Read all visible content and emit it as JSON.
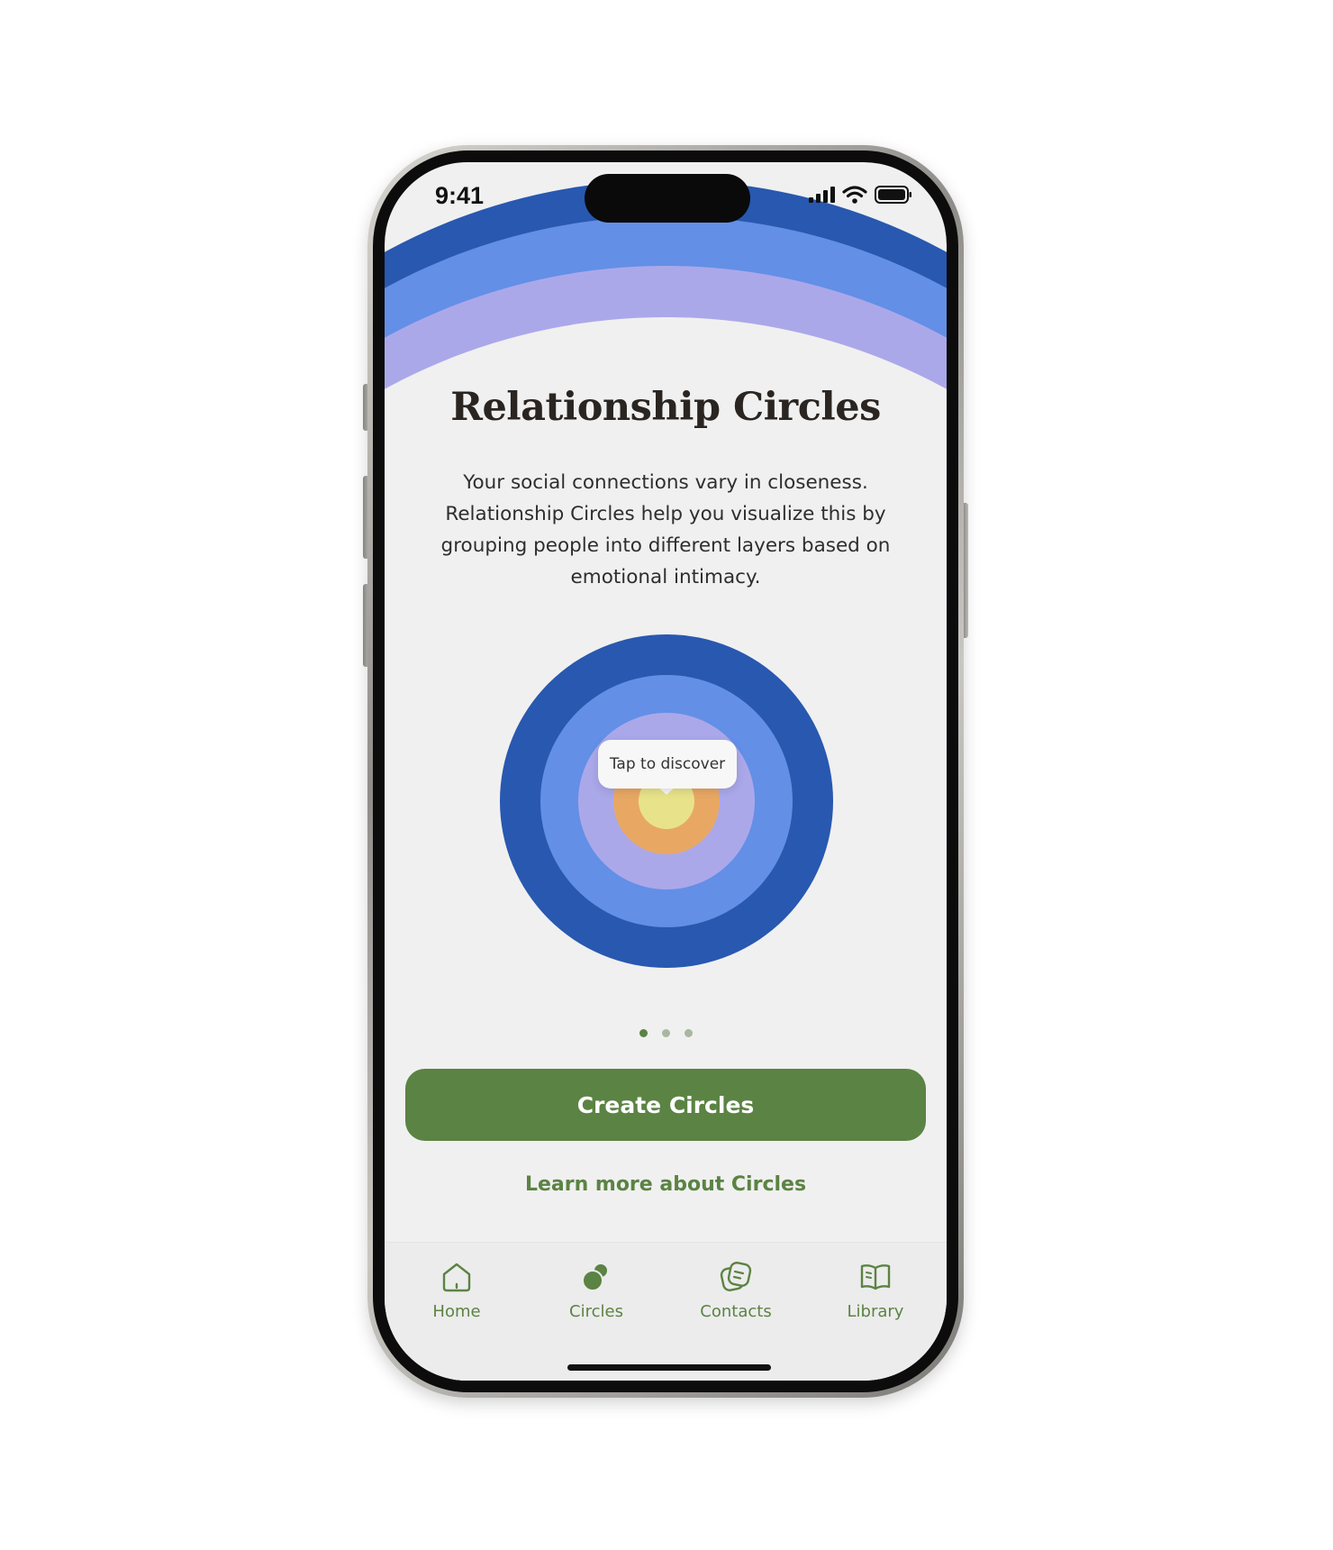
{
  "status_bar": {
    "time": "9:41"
  },
  "intro": {
    "title": "Relationship Circles",
    "description": "Your social connections vary in closeness. Relationship Circles help you visualize this by grouping people into different layers based on emotional intimacy."
  },
  "diagram": {
    "tooltip": "Tap to discover",
    "ring_colors": [
      "#2858b0",
      "#638fe6",
      "#aba8ea",
      "#e8a864",
      "#e8e38a"
    ]
  },
  "pager": {
    "pages": 3,
    "active_index": 0
  },
  "actions": {
    "primary_label": "Create Circles",
    "link_label": "Learn more about Circles"
  },
  "tab_bar": {
    "items": [
      {
        "label": "Home",
        "icon": "home-icon"
      },
      {
        "label": "Circles",
        "icon": "circles-icon"
      },
      {
        "label": "Contacts",
        "icon": "contacts-icon"
      },
      {
        "label": "Library",
        "icon": "library-icon"
      }
    ],
    "active_index": 1
  },
  "colors": {
    "accent": "#5b8343",
    "header_blue": "#2858b0",
    "header_light_blue": "#638fe6",
    "header_lavender": "#aba8ea",
    "background": "#f0f0f0"
  }
}
